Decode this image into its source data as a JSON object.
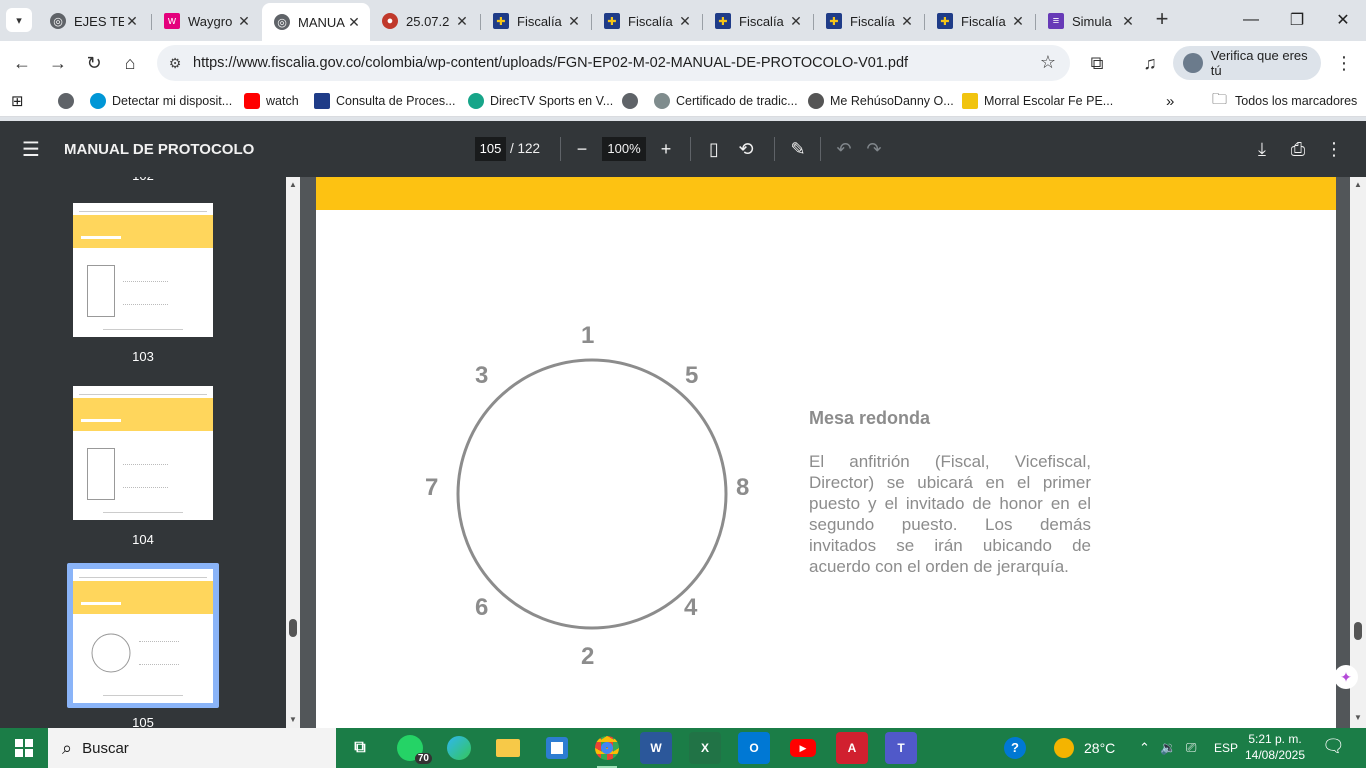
{
  "tabs": [
    {
      "label": "EJES TE",
      "icon": "globe-icon"
    },
    {
      "label": "Waygro",
      "icon": "waygroup-icon"
    },
    {
      "label": "MANUA",
      "icon": "globe-icon",
      "active": true
    },
    {
      "label": "25.07.2",
      "icon": "sports-icon"
    },
    {
      "label": "Fiscalía",
      "icon": "fiscalia-icon"
    },
    {
      "label": "Fiscalía",
      "icon": "fiscalia-icon"
    },
    {
      "label": "Fiscalía",
      "icon": "fiscalia-icon"
    },
    {
      "label": "Fiscalía",
      "icon": "fiscalia-icon"
    },
    {
      "label": "Fiscalía",
      "icon": "fiscalia-icon"
    },
    {
      "label": "Simula",
      "icon": "forms-icon"
    }
  ],
  "toolbar": {
    "url": "https://www.fiscalia.gov.co/colombia/wp-content/uploads/FGN-EP02-M-02-MANUAL-DE-PROTOCOLO-V01.pdf",
    "verify_label": "Verifica que eres tú"
  },
  "bookmarks": [
    {
      "label": "Detectar mi disposit...",
      "color": "#0096d6"
    },
    {
      "label": "watch",
      "color": "#ff0000"
    },
    {
      "label": "Consulta de Proces...",
      "color": "#1f3c88"
    },
    {
      "label": "DirecTV Sports en V...",
      "color": "#17a589"
    },
    {
      "label": "Certificado de tradic...",
      "color": "#7f8c8d"
    },
    {
      "label": "Me RehúsoDanny O...",
      "color": "#555555"
    },
    {
      "label": "Morral Escolar Fe PE...",
      "color": "#f1c40f"
    }
  ],
  "bookmarks_all": "Todos los marcadores",
  "pdf": {
    "title": "MANUAL DE PROTOCOLO",
    "current_page": "105",
    "total_pages": "/ 122",
    "zoom": "100%",
    "thumbnails": [
      {
        "number": "103"
      },
      {
        "number": "104"
      },
      {
        "number": "105",
        "selected": true
      }
    ],
    "partial_top_number": "102"
  },
  "content": {
    "seats": [
      "1",
      "5",
      "8",
      "4",
      "2",
      "6",
      "7",
      "3"
    ],
    "title": "Mesa redonda",
    "text": "El anfitrión (Fiscal, Vicefiscal, Director) se ubicará en el primer puesto y el invitado de honor en el segundo puesto. Los demás invitados se irán ubicando de acuerdo con el orden de jerarquía."
  },
  "taskbar": {
    "search_placeholder": "Buscar",
    "whatsapp_badge": "70",
    "temperature": "28°C",
    "language": "ESP",
    "time": "5:21 p. m.",
    "date": "14/08/2025"
  }
}
